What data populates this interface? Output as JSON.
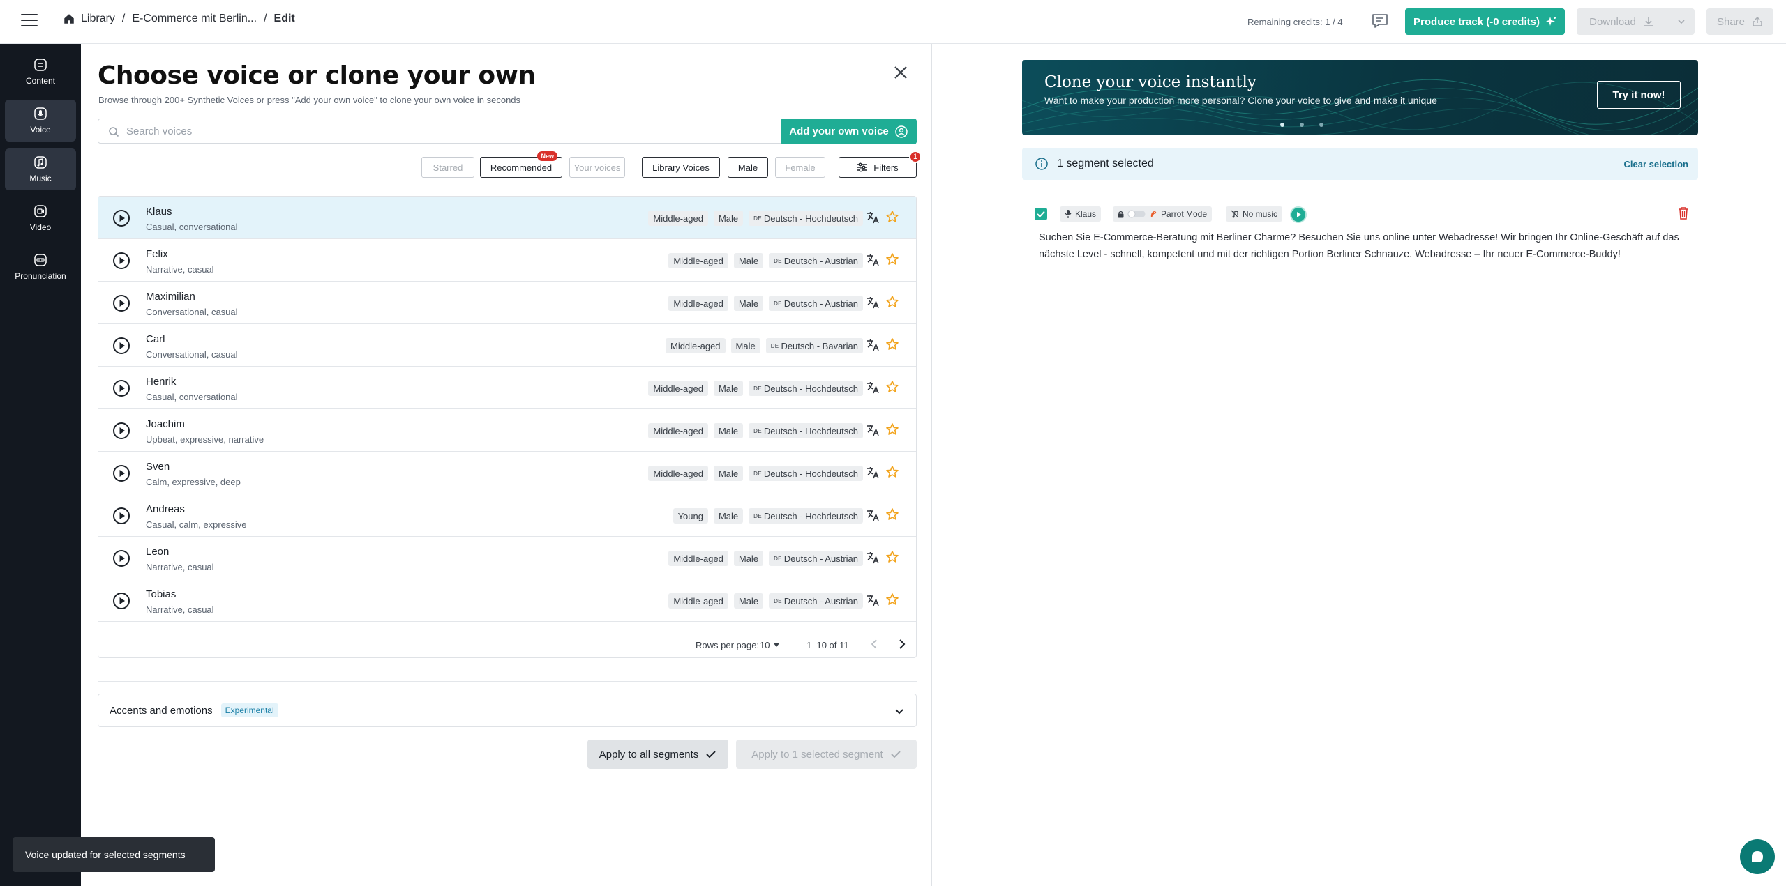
{
  "breadcrumb": {
    "library": "Library",
    "project": "E-Commerce mit Berlin...",
    "current": "Edit"
  },
  "header": {
    "credits": "Remaining credits: 1 / 4",
    "produce_label": "Produce track (-0 credits)",
    "download_label": "Download",
    "share_label": "Share"
  },
  "nav": [
    {
      "label": "Content",
      "icon": "content-icon"
    },
    {
      "label": "Voice",
      "icon": "microphone-icon"
    },
    {
      "label": "Music",
      "icon": "music-icon"
    },
    {
      "label": "Video",
      "icon": "video-icon"
    },
    {
      "label": "Pronunciation",
      "icon": "pronunciation-icon"
    }
  ],
  "panel": {
    "title": "Choose voice or clone your own",
    "subtitle": "Browse through 200+ Synthetic Voices or press \"Add your own voice\" to clone your own voice in seconds",
    "search_placeholder": "Search voices",
    "add_voice_label": "Add your own voice"
  },
  "filters": {
    "starred": "Starred",
    "recommended": "Recommended",
    "new_badge": "New",
    "your_voices": "Your voices",
    "library_voices": "Library Voices",
    "male": "Male",
    "female": "Female",
    "filters_label": "Filters",
    "filters_count": "1"
  },
  "voices": [
    {
      "name": "Klaus",
      "desc": "Casual, conversational",
      "age": "Middle-aged",
      "gender": "Male",
      "lang_code": "DE",
      "lang": "Deutsch - Hochdeutsch"
    },
    {
      "name": "Felix",
      "desc": "Narrative, casual",
      "age": "Middle-aged",
      "gender": "Male",
      "lang_code": "DE",
      "lang": "Deutsch - Austrian"
    },
    {
      "name": "Maximilian",
      "desc": "Conversational, casual",
      "age": "Middle-aged",
      "gender": "Male",
      "lang_code": "DE",
      "lang": "Deutsch - Austrian"
    },
    {
      "name": "Carl",
      "desc": "Conversational, casual",
      "age": "Middle-aged",
      "gender": "Male",
      "lang_code": "DE",
      "lang": "Deutsch - Bavarian"
    },
    {
      "name": "Henrik",
      "desc": "Casual, conversational",
      "age": "Middle-aged",
      "gender": "Male",
      "lang_code": "DE",
      "lang": "Deutsch - Hochdeutsch"
    },
    {
      "name": "Joachim",
      "desc": "Upbeat, expressive, narrative",
      "age": "Middle-aged",
      "gender": "Male",
      "lang_code": "DE",
      "lang": "Deutsch - Hochdeutsch"
    },
    {
      "name": "Sven",
      "desc": "Calm, expressive, deep",
      "age": "Middle-aged",
      "gender": "Male",
      "lang_code": "DE",
      "lang": "Deutsch - Hochdeutsch"
    },
    {
      "name": "Andreas",
      "desc": "Casual, calm, expressive",
      "age": "Young",
      "gender": "Male",
      "lang_code": "DE",
      "lang": "Deutsch - Hochdeutsch"
    },
    {
      "name": "Leon",
      "desc": "Narrative, casual",
      "age": "Middle-aged",
      "gender": "Male",
      "lang_code": "DE",
      "lang": "Deutsch - Austrian"
    },
    {
      "name": "Tobias",
      "desc": "Narrative, casual",
      "age": "Middle-aged",
      "gender": "Male",
      "lang_code": "DE",
      "lang": "Deutsch - Austrian"
    }
  ],
  "pager": {
    "rows_label": "Rows per page:",
    "rows_value": "10",
    "range": "1–10 of 11"
  },
  "accents": {
    "title": "Accents and emotions",
    "badge": "Experimental"
  },
  "apply": {
    "all_label": "Apply to all segments",
    "selected_label": "Apply to 1 selected segment"
  },
  "toast": "Voice updated for selected segments",
  "banner": {
    "title": "Clone your voice instantly",
    "subtitle": "Want to make your production more personal? Clone your voice to give and make it unique",
    "cta": "Try it now!"
  },
  "selection": {
    "text": "1 segment selected",
    "clear": "Clear selection"
  },
  "segment": {
    "voice": "Klaus",
    "parrot": "Parrot Mode",
    "music": "No music",
    "text": "Suchen Sie E-Commerce-Beratung mit Berliner Charme? Besuchen Sie uns online unter Webadresse! Wir bringen Ihr Online-Geschäft auf das nächste Level - schnell, kompetent und mit der richtigen Portion Berliner Schnauze. Webadresse – Ihr neuer E-Commerce-Buddy!"
  },
  "colors": {
    "accent": "#1fad95",
    "nav_bg": "#131820",
    "selected_row": "#e3f3fa",
    "star": "#f2a31b"
  }
}
